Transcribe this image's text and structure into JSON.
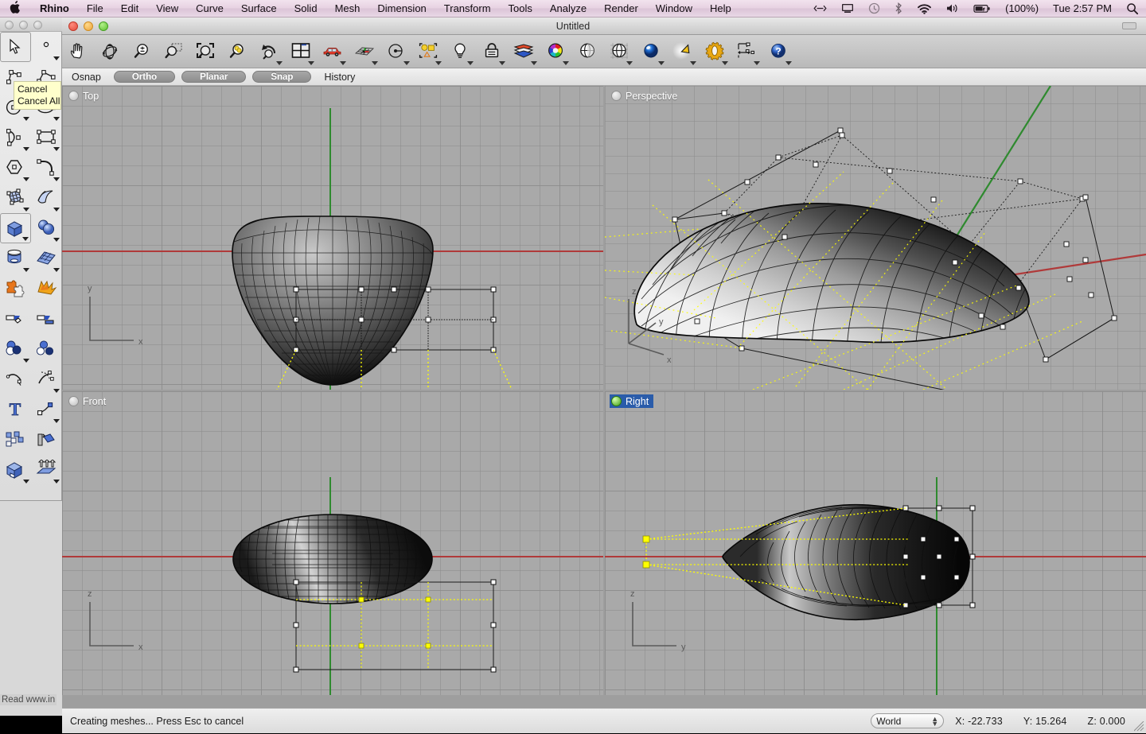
{
  "menubar": {
    "apple": "apple-logo",
    "items": [
      "Rhino",
      "File",
      "Edit",
      "View",
      "Curve",
      "Surface",
      "Solid",
      "Mesh",
      "Dimension",
      "Transform",
      "Tools",
      "Analyze",
      "Render",
      "Window",
      "Help"
    ],
    "right": {
      "arrows": "<‑‑>",
      "battery_pct": "(100%)",
      "clock": "Tue 2:57 PM",
      "icons": [
        "arrows-icon",
        "display-icon",
        "time-machine-icon",
        "bluetooth-icon",
        "wifi-icon",
        "volume-icon",
        "battery-icon",
        "spotlight-search-icon"
      ]
    }
  },
  "window": {
    "title": "Untitled"
  },
  "toolbar": {
    "buttons": [
      {
        "name": "pan-icon",
        "dropdown": false
      },
      {
        "name": "rotate-view-icon",
        "dropdown": false
      },
      {
        "name": "zoom-icon",
        "dropdown": false
      },
      {
        "name": "zoom-window-icon",
        "dropdown": false
      },
      {
        "name": "zoom-extents-icon",
        "dropdown": false
      },
      {
        "name": "zoom-selected-icon",
        "dropdown": false
      },
      {
        "name": "undo-view-icon",
        "dropdown": true
      },
      {
        "name": "viewport-layout-icon",
        "dropdown": true
      },
      {
        "name": "named-view-car-icon",
        "dropdown": true
      },
      {
        "name": "cplane-grid-icon",
        "dropdown": true
      },
      {
        "name": "set-cplane-icon",
        "dropdown": true
      },
      {
        "name": "select-objects-icon",
        "dropdown": true
      },
      {
        "name": "light-bulb-icon",
        "dropdown": true
      },
      {
        "name": "lock-object-icon",
        "dropdown": true
      },
      {
        "name": "surface-tools-icon",
        "dropdown": true
      },
      {
        "name": "object-color-wheel-icon",
        "dropdown": true
      },
      {
        "name": "wireframe-display-icon",
        "dropdown": false
      },
      {
        "name": "shaded-display-icon",
        "dropdown": true
      },
      {
        "name": "rendered-display-icon",
        "dropdown": true
      },
      {
        "name": "spotlight-cone-icon",
        "dropdown": true
      },
      {
        "name": "options-gear-icon",
        "dropdown": true
      },
      {
        "name": "dimension-icon",
        "dropdown": true
      },
      {
        "name": "help-icon",
        "dropdown": true
      }
    ]
  },
  "osnap_bar": {
    "osnap_label": "Osnap",
    "toggles": [
      "Ortho",
      "Planar",
      "Snap"
    ],
    "history_label": "History"
  },
  "sidebar": {
    "rows": [
      [
        {
          "name": "select-arrow-tool",
          "selected": true,
          "dropdown": false
        },
        {
          "name": "point-tool",
          "selected": false,
          "dropdown": true
        }
      ],
      [
        {
          "name": "control-point-curve-tool",
          "selected": false,
          "dropdown": true
        },
        {
          "name": "polyline-tool",
          "selected": false,
          "dropdown": true
        }
      ],
      [
        {
          "name": "circle-tool",
          "selected": false,
          "dropdown": true
        },
        {
          "name": "ellipse-tool",
          "selected": false,
          "dropdown": true
        }
      ],
      [
        {
          "name": "arc-tool",
          "selected": false,
          "dropdown": true
        },
        {
          "name": "rectangle-tool",
          "selected": false,
          "dropdown": true
        }
      ],
      [
        {
          "name": "polygon-tool",
          "selected": false,
          "dropdown": true
        },
        {
          "name": "curve-fillet-tool",
          "selected": false,
          "dropdown": true
        }
      ],
      [
        {
          "name": "surface-from-curves-tool",
          "selected": false,
          "dropdown": true
        },
        {
          "name": "surface-sweep-tool",
          "selected": false,
          "dropdown": true
        }
      ],
      [
        {
          "name": "box-tool",
          "selected": true,
          "dropdown": true
        },
        {
          "name": "sphere-tool",
          "selected": false,
          "dropdown": true
        }
      ],
      [
        {
          "name": "cylinder-tool",
          "selected": false,
          "dropdown": true
        },
        {
          "name": "mesh-plane-tool",
          "selected": false,
          "dropdown": true
        }
      ],
      [
        {
          "name": "boolean-tool",
          "selected": false,
          "dropdown": false
        },
        {
          "name": "explode-tool",
          "selected": false,
          "dropdown": false
        }
      ],
      [
        {
          "name": "trim-tool",
          "selected": false,
          "dropdown": false
        },
        {
          "name": "split-tool",
          "selected": false,
          "dropdown": false
        }
      ],
      [
        {
          "name": "boolean-union-tool",
          "selected": false,
          "dropdown": true
        },
        {
          "name": "boolean-difference-tool",
          "selected": false,
          "dropdown": false
        }
      ],
      [
        {
          "name": "fillet-curve-tool",
          "selected": false,
          "dropdown": false
        },
        {
          "name": "offset-curve-tool",
          "selected": false,
          "dropdown": true
        }
      ],
      [
        {
          "name": "text-tool",
          "selected": false,
          "dropdown": false
        },
        {
          "name": "polyline-edit-tool",
          "selected": false,
          "dropdown": true
        }
      ],
      [
        {
          "name": "array-tool",
          "selected": false,
          "dropdown": false
        },
        {
          "name": "mirror-tool",
          "selected": false,
          "dropdown": false
        }
      ],
      [
        {
          "name": "solid-boolean-tool",
          "selected": false,
          "dropdown": true
        },
        {
          "name": "extrude-tool",
          "selected": false,
          "dropdown": true
        }
      ]
    ]
  },
  "tooltip": {
    "lines": [
      "Cancel",
      "Cancel All"
    ]
  },
  "viewports": [
    {
      "name": "Top",
      "active": false,
      "axes": [
        "y",
        "x"
      ]
    },
    {
      "name": "Perspective",
      "active": false,
      "axes": [
        "z",
        "y",
        "x"
      ]
    },
    {
      "name": "Front",
      "active": false,
      "axes": [
        "z",
        "x"
      ]
    },
    {
      "name": "Right",
      "active": true,
      "axes": [
        "z",
        "y"
      ]
    }
  ],
  "statusbar": {
    "command": "Creating meshes... Press Esc to cancel",
    "cplane": "World",
    "x": "X:  -22.733",
    "y": "Y:  15.264",
    "z": "Z:  0.000"
  },
  "background_text": "Read www.in",
  "colors": {
    "accent_blue": "#2a5caa",
    "xaxis_red": "#b03a3a",
    "yaxis_green": "#2f8a2f",
    "control_yellow": "#ffff00",
    "viewport_bg": "#a9a9a9",
    "tooltip_bg": "#ffffcc"
  }
}
